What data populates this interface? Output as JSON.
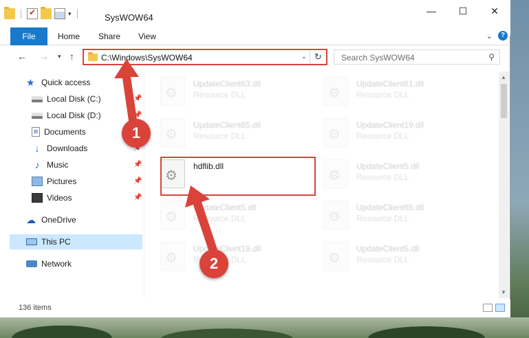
{
  "window": {
    "title": "SysWOW64",
    "minimize_glyph": "—",
    "maximize_glyph": "☐",
    "close_glyph": "✕"
  },
  "ribbon": {
    "tabs": [
      {
        "label": "File"
      },
      {
        "label": "Home"
      },
      {
        "label": "Share"
      },
      {
        "label": "View"
      }
    ],
    "expand_glyph": "⌄",
    "help_glyph": "?"
  },
  "navigation": {
    "back_glyph": "←",
    "forward_glyph": "→",
    "recent_glyph": "▾",
    "up_glyph": "↑",
    "address": "C:\\Windows\\SysWOW64",
    "address_dropdown_glyph": "⌄",
    "refresh_glyph": "↻",
    "search_placeholder": "Search SysWOW64",
    "search_glyph": "⚲"
  },
  "sidebar": {
    "items": [
      {
        "label": "Quick access",
        "icon": "star-icon",
        "pinned": false
      },
      {
        "label": "Local Disk (C:)",
        "icon": "disk-icon",
        "pinned": true
      },
      {
        "label": "Local Disk (D:)",
        "icon": "disk-icon",
        "pinned": true
      },
      {
        "label": "Documents",
        "icon": "documents-icon",
        "pinned": true
      },
      {
        "label": "Downloads",
        "icon": "download-icon",
        "pinned": true
      },
      {
        "label": "Music",
        "icon": "music-icon",
        "pinned": true
      },
      {
        "label": "Pictures",
        "icon": "pictures-icon",
        "pinned": true
      },
      {
        "label": "Videos",
        "icon": "videos-icon",
        "pinned": true
      },
      {
        "label": "OneDrive",
        "icon": "cloud-icon",
        "pinned": false
      },
      {
        "label": "This PC",
        "icon": "computer-icon",
        "pinned": false,
        "selected": true
      },
      {
        "label": "Network",
        "icon": "network-icon",
        "pinned": false
      }
    ],
    "pin_glyph": "📌"
  },
  "files": [
    {
      "name": "UpdateClient63.dll",
      "type": "Resource DLL",
      "highlighted": false
    },
    {
      "name": "UpdateClient61.dll",
      "type": "Resource DLL",
      "highlighted": false
    },
    {
      "name": "UpdateClient65.dll",
      "type": "Resource DLL",
      "highlighted": false
    },
    {
      "name": "UpdateClient19.dll",
      "type": "Resource DLL",
      "highlighted": false
    },
    {
      "name": "hdflib.dll",
      "type": "",
      "highlighted": true
    },
    {
      "name": "UpdateClient5.dll",
      "type": "Resource DLL",
      "highlighted": false
    },
    {
      "name": "UpdateClient5.dll",
      "type": "Resource DLL",
      "highlighted": false
    },
    {
      "name": "UpdateClient65.dll",
      "type": "Resource DLL",
      "highlighted": false
    },
    {
      "name": "UpdateClient19.dll",
      "type": "Resource DLL",
      "highlighted": false
    },
    {
      "name": "UpdateClient5.dll",
      "type": "Resource DLL",
      "highlighted": false
    }
  ],
  "status": {
    "item_count": "136 items"
  },
  "annotations": {
    "step1": "1",
    "step2": "2",
    "color": "#d9433a"
  },
  "colors": {
    "accent": "#1979ca",
    "selection": "#cce8ff",
    "annotation_red": "#d9433a"
  }
}
